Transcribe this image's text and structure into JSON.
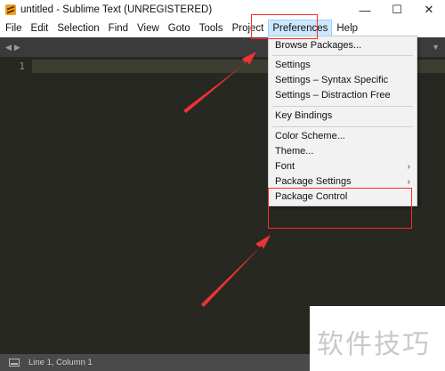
{
  "window": {
    "title": "untitled - Sublime Text (UNREGISTERED)",
    "controls": {
      "minimize": "—",
      "maximize": "☐",
      "close": "✕"
    }
  },
  "menubar": {
    "items": [
      "File",
      "Edit",
      "Selection",
      "Find",
      "View",
      "Goto",
      "Tools",
      "Project",
      "Preferences",
      "Help"
    ],
    "active": "Preferences"
  },
  "tabstrip": {
    "nav_left": "◀",
    "nav_right": "▶",
    "dropdown": "▼"
  },
  "editor": {
    "line_number": "1",
    "background": "#272822",
    "line_number_color": "#8f908a"
  },
  "preferences_menu": {
    "items": [
      {
        "label": "Browse Packages..."
      },
      {
        "label": "Settings"
      },
      {
        "label": "Settings – Syntax Specific"
      },
      {
        "label": "Settings – Distraction Free"
      },
      {
        "label": "Key Bindings"
      },
      {
        "label": "Color Scheme..."
      },
      {
        "label": "Theme..."
      },
      {
        "label": "Font",
        "submenu_arrow": "›"
      },
      {
        "label": "Package Settings",
        "submenu_arrow": "›"
      },
      {
        "label": "Package Control"
      }
    ]
  },
  "statusbar": {
    "position": "Line 1, Column 1"
  },
  "annotation": {
    "color": "#ff2a2a"
  },
  "watermark": {
    "text": "软件技巧"
  }
}
